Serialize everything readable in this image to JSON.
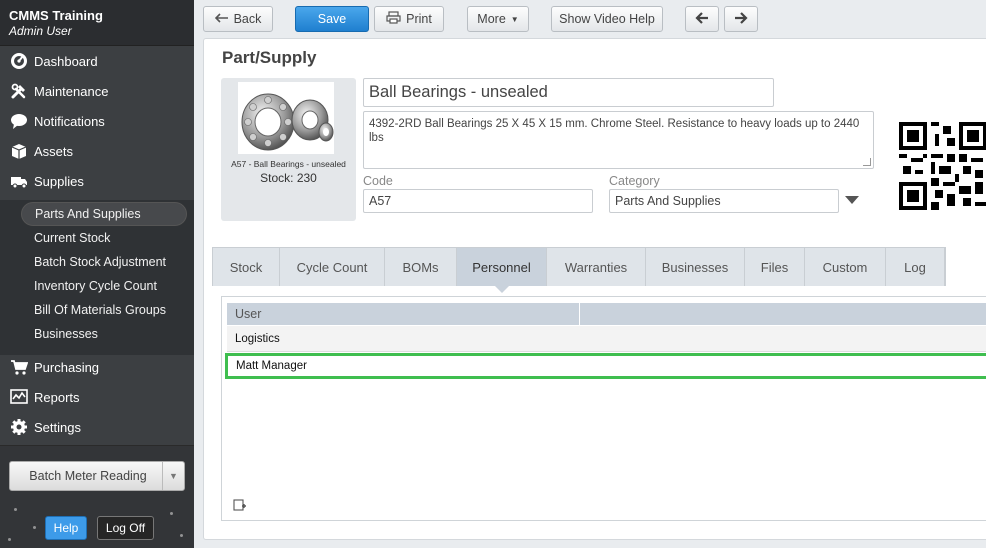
{
  "app": {
    "title": "CMMS Training",
    "user": "Admin User"
  },
  "sidebar": {
    "items": [
      {
        "label": "Dashboard",
        "icon": "dashboard-gauge-icon"
      },
      {
        "label": "Maintenance",
        "icon": "wrench-hammer-icon"
      },
      {
        "label": "Notifications",
        "icon": "speech-bubble-icon"
      },
      {
        "label": "Assets",
        "icon": "box-icon"
      },
      {
        "label": "Supplies",
        "icon": "truck-icon"
      },
      {
        "label": "Purchasing",
        "icon": "cart-icon"
      },
      {
        "label": "Reports",
        "icon": "chart-icon"
      },
      {
        "label": "Settings",
        "icon": "gear-icon"
      }
    ],
    "supplies_sub": [
      "Parts And Supplies",
      "Current Stock",
      "Batch Stock Adjustment",
      "Inventory Cycle Count",
      "Bill Of Materials Groups",
      "Businesses"
    ],
    "batch_button": "Batch Meter Reading",
    "help_button": "Help",
    "logoff_button": "Log Off"
  },
  "toolbar": {
    "back": "Back",
    "save": "Save",
    "print": "Print",
    "more": "More",
    "video_help": "Show Video Help"
  },
  "part": {
    "page_title": "Part/Supply",
    "name": "Ball Bearings - unsealed",
    "description": "4392-2RD Ball Bearings 25 X 45 X 15 mm. Chrome Steel. Resistance to heavy loads up to 2440 lbs",
    "thumb_caption": "A57 - Ball Bearings - unsealed",
    "stock_text": "Stock: 230",
    "code_label": "Code",
    "code_value": "A57",
    "category_label": "Category",
    "category_value": "Parts And Supplies"
  },
  "tabs": [
    "Stock",
    "Cycle Count",
    "BOMs",
    "Personnel",
    "Warranties",
    "Businesses",
    "Files",
    "Custom",
    "Log"
  ],
  "active_tab": "Personnel",
  "grid": {
    "column_header": "User",
    "group": "Logistics",
    "rows": [
      "Matt Manager"
    ]
  },
  "colors": {
    "sidebar_bg": "#3c3f42",
    "save_blue": "#2b8fde",
    "selected_row_border": "#3fbe4f",
    "tab_active": "#c9d2dc"
  }
}
